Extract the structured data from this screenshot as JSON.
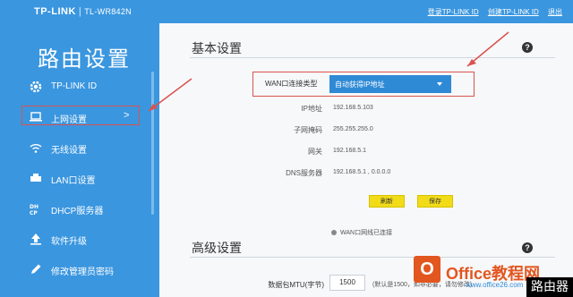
{
  "header": {
    "brand": "TP-LINK",
    "model": "TL-WR842N",
    "links": [
      "登录TP-LINK ID",
      "创建TP-LINK ID",
      "退出"
    ]
  },
  "sidebar": {
    "title": "路由设置",
    "items": [
      {
        "label": "TP-LINK ID",
        "icon": "gear-icon"
      },
      {
        "label": "上网设置",
        "icon": "laptop-icon"
      },
      {
        "label": "无线设置",
        "icon": "wifi-icon"
      },
      {
        "label": "LAN口设置",
        "icon": "lan-icon"
      },
      {
        "label": "DHCP服务器",
        "icon": "dhcp-icon"
      },
      {
        "label": "软件升级",
        "icon": "upload-icon"
      },
      {
        "label": "修改管理员密码",
        "icon": "pencil-icon"
      }
    ],
    "active_chevron": ">"
  },
  "basic": {
    "title": "基本设置",
    "help": "?",
    "wan_label": "WAN口连接类型",
    "wan_value": "自动获得IP地址",
    "rows": [
      {
        "label": "IP地址",
        "value": "192.168.5.103"
      },
      {
        "label": "子网掩码",
        "value": "255.255.255.0"
      },
      {
        "label": "网关",
        "value": "192.168.5.1"
      },
      {
        "label": "DNS服务器",
        "value": "192.168.5.1 , 0.0.0.0"
      }
    ],
    "refresh": "刷新",
    "save": "保存",
    "status": "WAN口网线已连接"
  },
  "advanced": {
    "title": "高级设置",
    "help": "?",
    "mtu_label": "数据包MTU(字节)",
    "mtu_value": "1500",
    "mtu_note": "(默认是1500，如非必要，请勿修改)"
  },
  "watermark": {
    "logo": "O",
    "text": "Office教程网",
    "sub": "www.office26.com",
    "corner": "路由器"
  },
  "colors": {
    "accent": "#3a96df",
    "highlight": "#d9534f",
    "button": "#f2dc18"
  }
}
